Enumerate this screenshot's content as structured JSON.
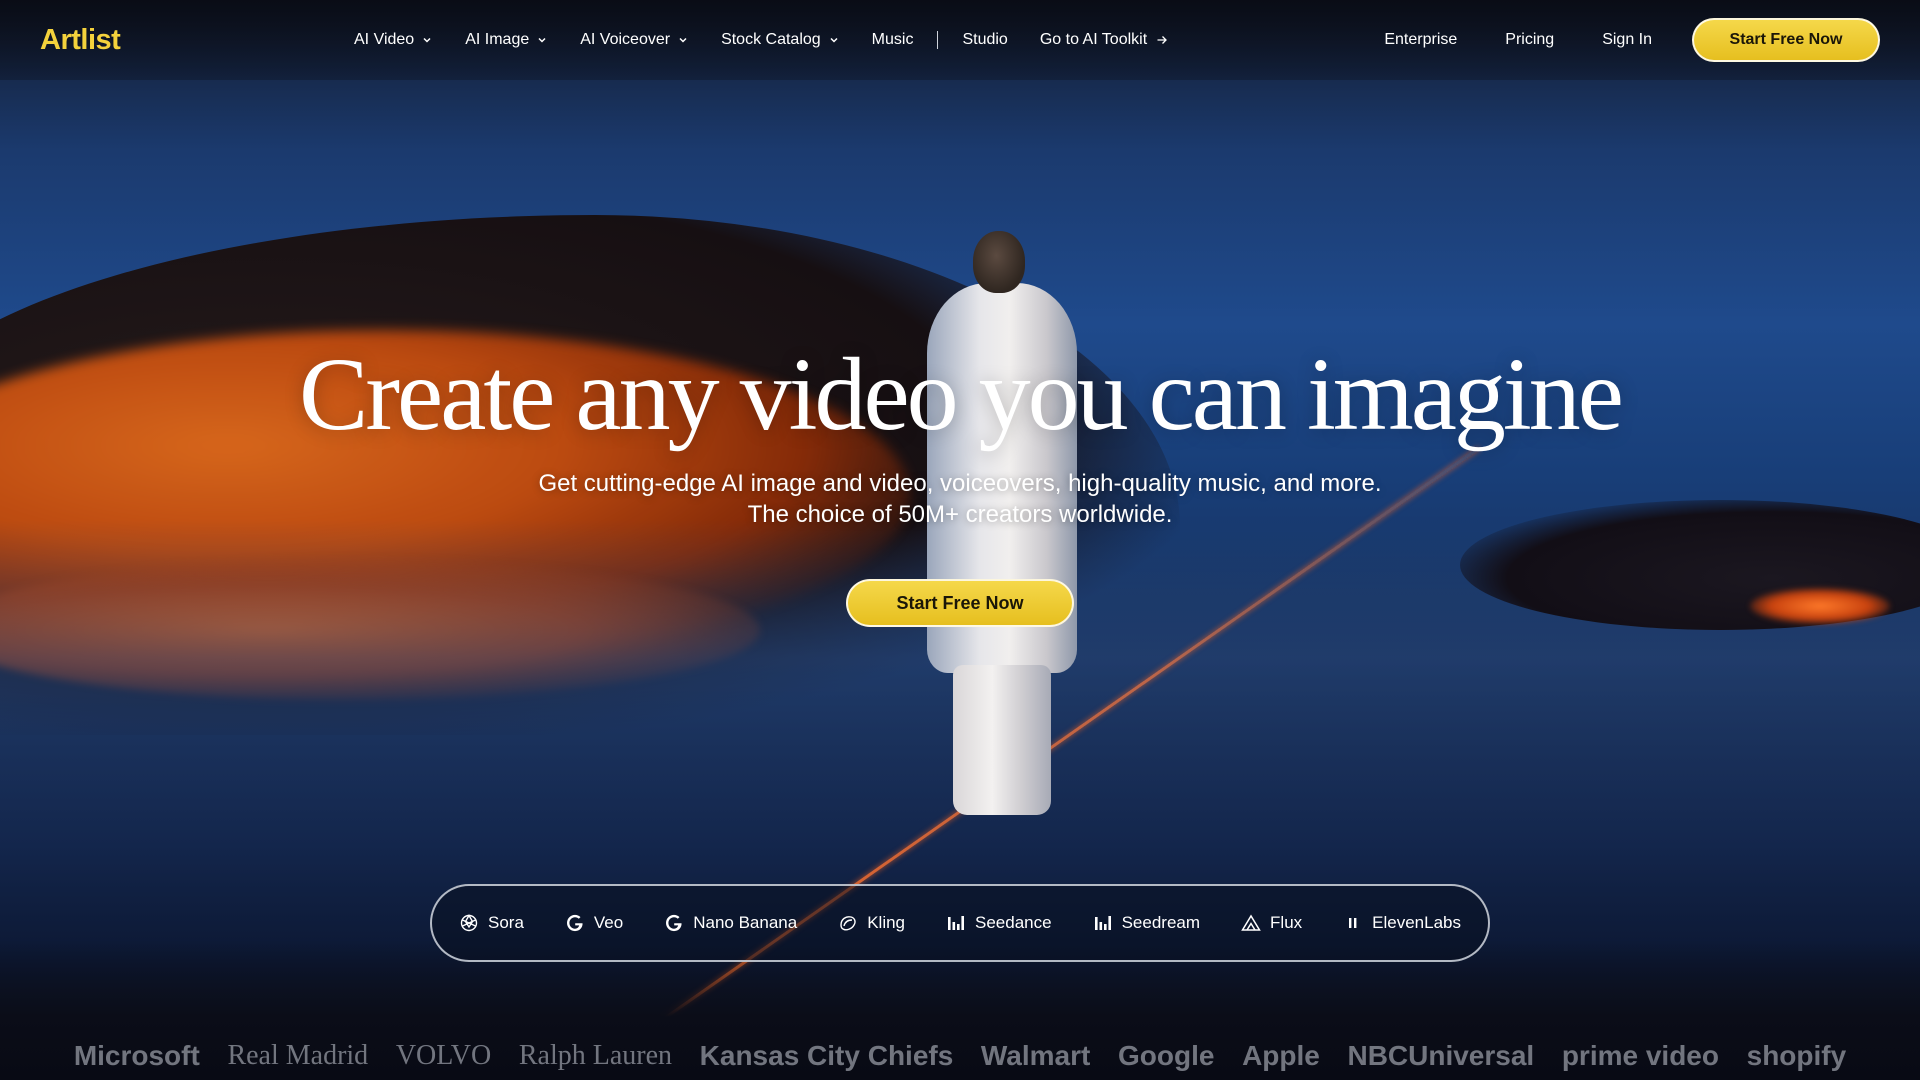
{
  "nav": {
    "logo": "Artlist",
    "items": [
      {
        "label": "AI Video",
        "dropdown": true
      },
      {
        "label": "AI Image",
        "dropdown": true
      },
      {
        "label": "AI Voiceover",
        "dropdown": true
      },
      {
        "label": "Stock Catalog",
        "dropdown": true
      },
      {
        "label": "Music",
        "dropdown": false
      },
      {
        "label": "Studio",
        "dropdown": false
      },
      {
        "label": "Go to AI Toolkit",
        "dropdown": false
      }
    ],
    "right": {
      "enterprise": "Enterprise",
      "pricing": "Pricing",
      "sign_in": "Sign In",
      "cta": "Start Free Now"
    }
  },
  "hero": {
    "title": "Create any video you can imagine",
    "subtitle_line1": "Get cutting-edge AI image and video, voiceovers, high-quality music, and more.",
    "subtitle_line2": "The choice of 50M+ creators worldwide.",
    "cta": "Start Free Now"
  },
  "models": [
    {
      "label": "Sora",
      "icon": "openai-icon"
    },
    {
      "label": "Veo",
      "icon": "google-g-icon"
    },
    {
      "label": "Nano Banana",
      "icon": "google-g-icon"
    },
    {
      "label": "Kling",
      "icon": "kling-icon"
    },
    {
      "label": "Seedance",
      "icon": "bars-icon"
    },
    {
      "label": "Seedream",
      "icon": "bars-icon"
    },
    {
      "label": "Flux",
      "icon": "triangle-icon"
    },
    {
      "label": "ElevenLabs",
      "icon": "pause-icon"
    }
  ],
  "brands": [
    "Microsoft",
    "Real Madrid",
    "VOLVO",
    "Ralph Lauren",
    "Kansas City Chiefs",
    "Walmart",
    "Google",
    "Apple",
    "NBCUniversal",
    "prime video",
    "shopify"
  ],
  "colors": {
    "accent": "#f0cd36",
    "logo": "#f4d23c",
    "background": "#0a1530"
  }
}
